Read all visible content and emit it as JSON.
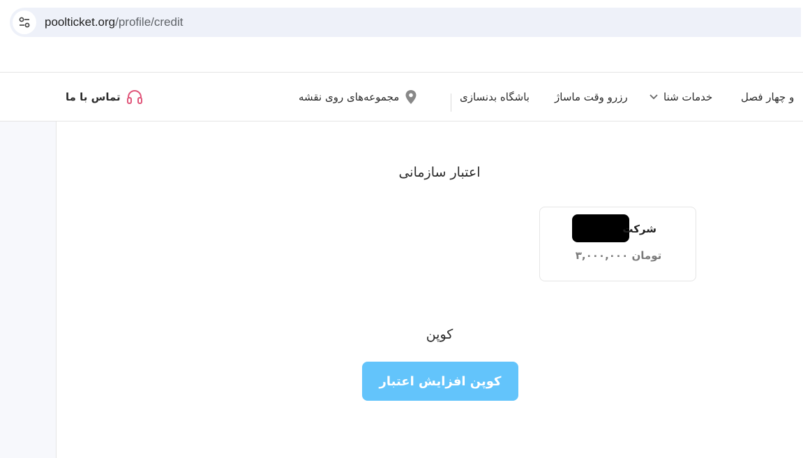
{
  "browser": {
    "url_host": "poolticket.org",
    "url_path": "/profile/credit"
  },
  "nav": {
    "contact_label": "تماس با ما",
    "map_label": "مجموعه‌های روی نقشه",
    "gym_label": "باشگاه بدنسازی",
    "massage_label": "رزرو وقت ماساژ",
    "swim_label": "خدمات شنا",
    "seasons_label": "و چهار فصل"
  },
  "credit": {
    "title": "اعتبار سازمانی",
    "org_name": "شرکت",
    "org_amount": "۳,۰۰۰,۰۰۰ تومان"
  },
  "coupon": {
    "title": "کوپن",
    "button_label": "کوپن افزایش اعتبار"
  },
  "colors": {
    "accent": "#63c4fb",
    "contact_icon": "#e0567a"
  },
  "icons": {
    "site_info": "tune-icon",
    "contact": "headset-icon",
    "map": "map-pin-icon",
    "swim_dropdown": "chevron-down-icon"
  }
}
